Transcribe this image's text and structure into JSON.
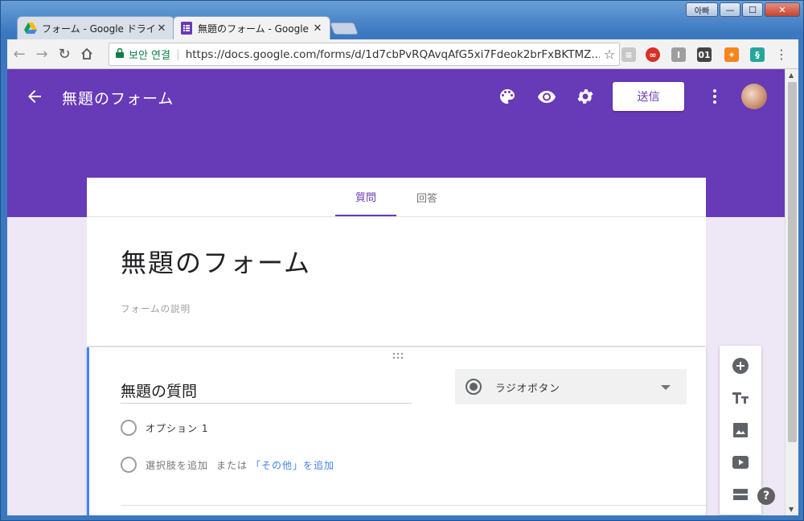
{
  "browser": {
    "tabs": [
      {
        "title": "フォーム - Google ドライ",
        "active": false,
        "icon": "google-drive-icon"
      },
      {
        "title": "無題のフォーム - Google フ",
        "active": true,
        "icon": "google-forms-icon"
      }
    ],
    "user_badge": "아빠",
    "secure_label": "보안 연결",
    "url": "https://docs.google.com/forms/d/1d7cbPvRQAvqAfG5xi7Fdeok2brFxBKTMZ...",
    "ext_labels": {
      "ext3": "I",
      "ext4": "01"
    }
  },
  "header": {
    "form_name": "無題のフォーム",
    "send_label": "送信",
    "accent": "#673ab7"
  },
  "tabs": {
    "questions": "質問",
    "responses": "回答"
  },
  "form": {
    "title": "無題のフォーム",
    "description_placeholder": "フォームの説明"
  },
  "question": {
    "title": "無題の質問",
    "type": "ラジオボタン",
    "option1": "オプション 1",
    "add_option": "選択肢を追加",
    "or": "または",
    "add_other": "「その他」を追加"
  },
  "help": "?"
}
